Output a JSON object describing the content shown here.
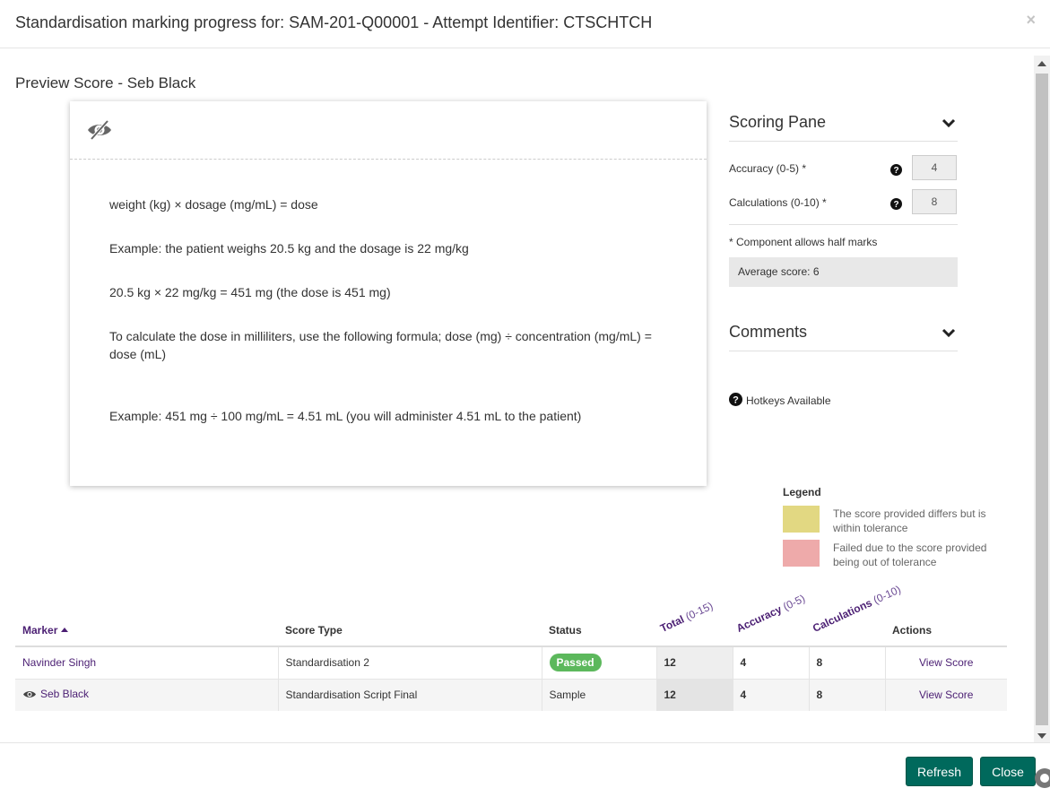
{
  "header": {
    "title": "Standardisation marking progress for: SAM-201-Q00001 - Attempt Identifier: CTSCHTCH",
    "close_label": "×"
  },
  "preview": {
    "title": "Preview Score - Seb Black",
    "paragraphs": [
      "weight (kg) × dosage (mg/mL) = dose",
      "Example: the patient weighs 20.5 kg and the dosage is 22 mg/kg",
      "20.5 kg × 22 mg/kg = 451 mg (the dose is 451 mg)",
      "To calculate the dose in milliliters, use the following formula; dose (mg) ÷ concentration (mg/mL) = dose (mL)",
      "Example: 451 mg ÷ 100 mg/mL = 4.51 mL (you will administer 4.51 mL to the patient)"
    ]
  },
  "scoring_pane": {
    "title": "Scoring Pane",
    "criteria": [
      {
        "label": "Accuracy (0-5) *",
        "value": "4"
      },
      {
        "label": "Calculations (0-10) *",
        "value": "8"
      }
    ],
    "half_marks_note": "* Component allows half marks",
    "average_score": "Average score: 6"
  },
  "comments": {
    "title": "Comments"
  },
  "hotkeys": {
    "label": "Hotkeys Available"
  },
  "legend": {
    "title": "Legend",
    "items": [
      {
        "text": "The score provided differs but is within tolerance",
        "color": "#e2d882"
      },
      {
        "text": "Failed due to the score provided being out of tolerance",
        "color": "#eeaaaa"
      }
    ]
  },
  "table": {
    "headers": {
      "marker": "Marker",
      "score_type": "Score Type",
      "status": "Status",
      "total": "Total",
      "total_range": "(0-15)",
      "accuracy": "Accuracy",
      "accuracy_range": "(0-5)",
      "calculations": "Calculations",
      "calculations_range": "(0-10)",
      "actions": "Actions"
    },
    "rows": [
      {
        "marker": "Navinder Singh",
        "score_type": "Standardisation 2",
        "status": "Passed",
        "total": "12",
        "accuracy": "4",
        "calculations": "8",
        "action": "View Score"
      },
      {
        "marker": "Seb Black",
        "score_type": "Standardisation Script Final",
        "status": "Sample",
        "total": "12",
        "accuracy": "4",
        "calculations": "8",
        "action": "View Score"
      }
    ]
  },
  "footer": {
    "refresh_label": "Refresh",
    "close_label": "Close"
  },
  "colors": {
    "primary_button": "#00695c",
    "link": "#4b1f73",
    "passed_badge": "#5cb85c"
  }
}
